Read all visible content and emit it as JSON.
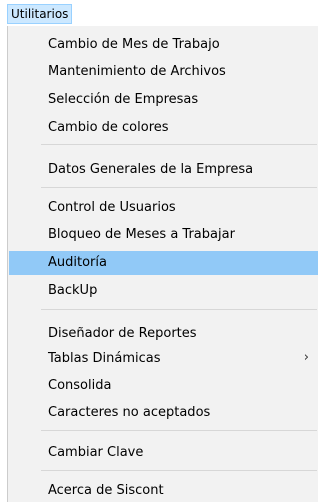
{
  "menu": {
    "title": "Utilitarios"
  },
  "items": {
    "cambio_mes": "Cambio de Mes de Trabajo",
    "mantenimiento": "Mantenimiento de Archivos",
    "seleccion_empresas": "Selección de Empresas",
    "cambio_colores": "Cambio de colores",
    "datos_generales": "Datos Generales de la Empresa",
    "control_usuarios": "Control de Usuarios",
    "bloqueo_meses": "Bloqueo de Meses a Trabajar",
    "auditoria": "Auditoría",
    "backup": "BackUp",
    "disenador_reportes": "Diseñador de Reportes",
    "tablas_dinamicas": "Tablas Dinámicas",
    "consolida": "Consolida",
    "caracteres": "Caracteres no aceptados",
    "cambiar_clave": "Cambiar Clave",
    "acerca": "Acerca de Siscont"
  },
  "submenu_arrow": "›",
  "colors": {
    "menu_bg": "#f2f2f2",
    "highlight": "#91c9f7",
    "title_bg": "#cce8ff"
  }
}
